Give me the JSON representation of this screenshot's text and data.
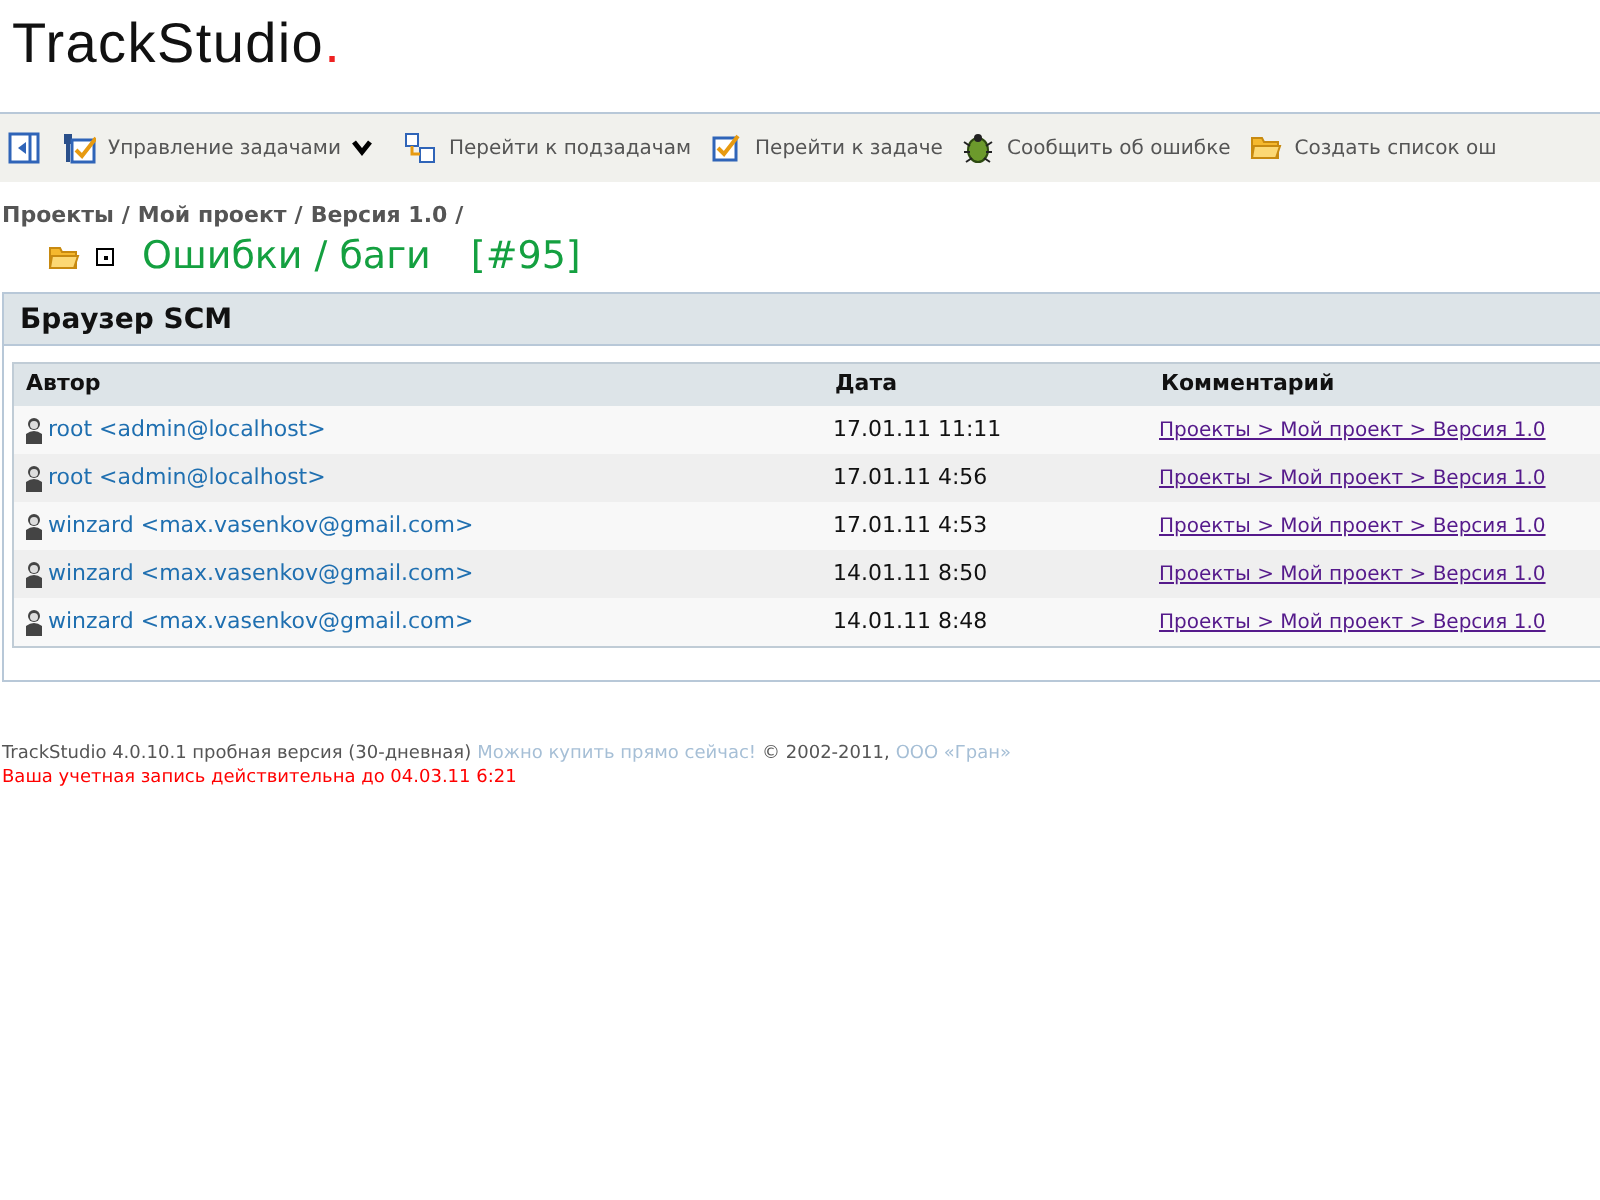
{
  "logo": {
    "text": "TrackStudio",
    "dot": "."
  },
  "toolbar": [
    {
      "kind": "collapse"
    },
    {
      "kind": "menu",
      "label": "Управление задачами"
    },
    {
      "kind": "link",
      "label": "Перейти к подзадачам"
    },
    {
      "kind": "link",
      "label": "Перейти к задаче"
    },
    {
      "kind": "link",
      "label": "Сообщить об ошибке"
    },
    {
      "kind": "link",
      "label": "Создать список ош"
    }
  ],
  "breadcrumb": [
    {
      "label": "Проекты",
      "separator": "/"
    },
    {
      "label": "Мой проект",
      "separator": "/"
    },
    {
      "label": "Версия 1.0",
      "separator": "/"
    }
  ],
  "task": {
    "title": "Ошибки / баги",
    "number": "[#95]",
    "expanded": false
  },
  "panel": {
    "title": "Браузер SCM"
  },
  "table": {
    "columns": [
      "Автор",
      "Дата",
      "Комментарий"
    ],
    "rows": [
      {
        "author": "root <admin@localhost>",
        "date": "17.01.11 11:11",
        "comment": "Проекты > Мой проект > Версия 1.0"
      },
      {
        "author": "root <admin@localhost>",
        "date": "17.01.11 4:56",
        "comment": "Проекты > Мой проект > Версия 1.0"
      },
      {
        "author": "winzard <max.vasenkov@gmail.com>",
        "date": "17.01.11 4:53",
        "comment": "Проекты > Мой проект > Версия 1.0"
      },
      {
        "author": "winzard <max.vasenkov@gmail.com>",
        "date": "14.01.11 8:50",
        "comment": "Проекты > Мой проект > Версия 1.0"
      },
      {
        "author": "winzard <max.vasenkov@gmail.com>",
        "date": "14.01.11 8:48",
        "comment": "Проекты > Мой проект > Версия 1.0"
      }
    ]
  },
  "footer": {
    "line1": [
      {
        "kind": "text",
        "text": "TrackStudio 4.0.10.1 пробная версия (30-дневная)"
      },
      {
        "kind": "link",
        "text": "Можно купить прямо сейчас!"
      },
      {
        "kind": "text",
        "text": "© 2002-2011,"
      },
      {
        "kind": "link",
        "text": "ООО «Гран»"
      }
    ],
    "warning": "Ваша учетная запись действительна до 04.03.11 6:21"
  }
}
